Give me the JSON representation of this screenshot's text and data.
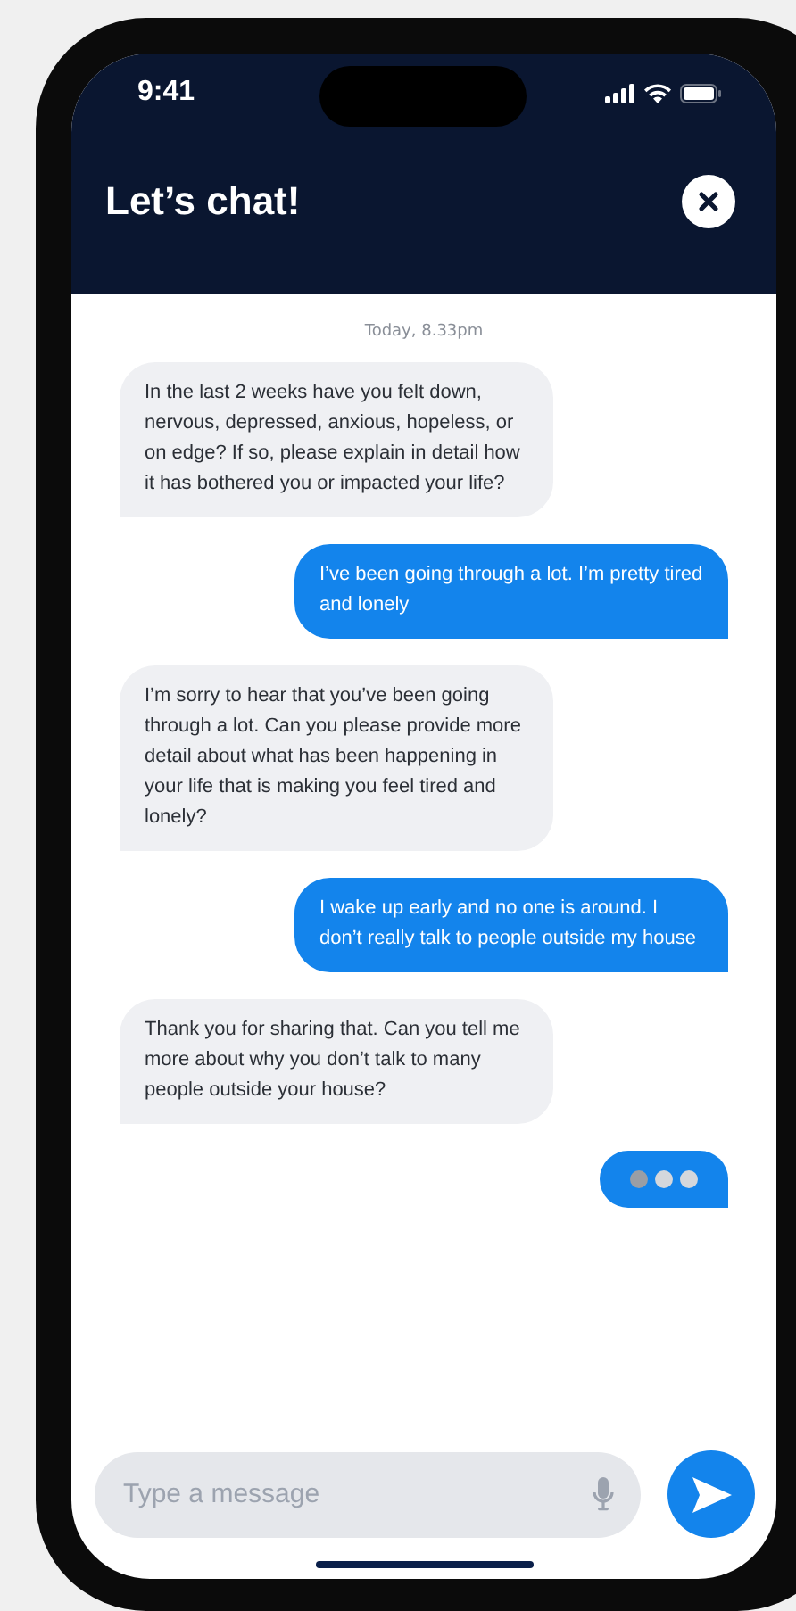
{
  "status_bar": {
    "time": "9:41"
  },
  "header": {
    "title": "Let’s chat!"
  },
  "chat": {
    "timestamp": "Today, 8.33pm",
    "messages": [
      {
        "kind": "incoming",
        "text": "In the last 2 weeks have you felt down, nervous, depressed, anxious, hopeless, or on edge? If so, please explain in detail how it has bothered you or impacted your life?"
      },
      {
        "kind": "outgoing",
        "text": "I’ve been going through a lot. I’m pretty tired and lonely"
      },
      {
        "kind": "incoming",
        "text": "I’m sorry to hear that you’ve been going through a lot. Can you please provide more detail about what has been happening in your life that is making you feel tired and lonely?"
      },
      {
        "kind": "outgoing",
        "text": "I wake up early and no one is around. I don’t really talk to people outside my house"
      },
      {
        "kind": "incoming",
        "text": "Thank you for sharing that. Can you tell me more about why you don’t talk to many people outside your house?"
      },
      {
        "kind": "typing"
      }
    ]
  },
  "composer": {
    "placeholder": "Type a message"
  }
}
